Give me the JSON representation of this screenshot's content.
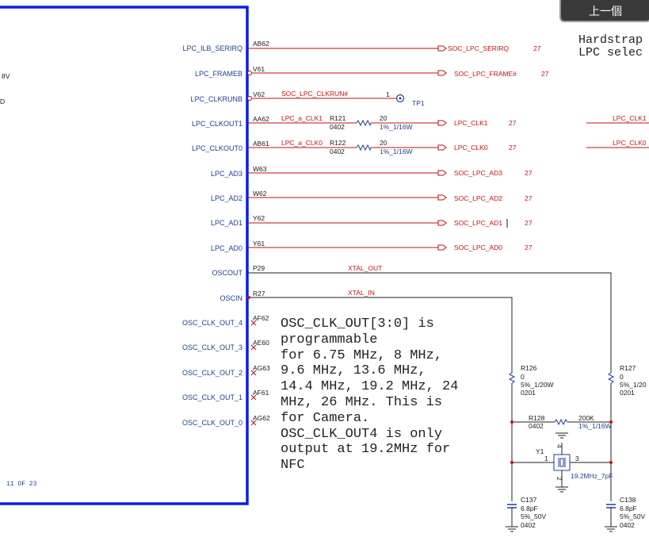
{
  "prev_button": "上一個",
  "hardstrap": [
    "Hardstrap",
    "LPC selec"
  ],
  "left_fragments": {
    "v": "8V",
    "d": "D"
  },
  "page_label": "11 OF 23",
  "pins": [
    {
      "name": "LPC_ILB_SERIRQ",
      "ball": "AB62",
      "net": "SOC_LPC_SERIRQ",
      "page": "27"
    },
    {
      "name": "LPC_FRAMEB",
      "ball": "V61",
      "net": "SOC_LPC_FRAME#",
      "page": "27"
    },
    {
      "name": "LPC_CLKRUNB",
      "ball": "V62",
      "net": "SOC_LPC_CLKRUN#",
      "page": ""
    },
    {
      "name": "LPC_CLKOUT1",
      "ball": "AA62",
      "net": "LPC_a_CLK1",
      "page": ""
    },
    {
      "name": "LPC_CLKOUT0",
      "ball": "AB61",
      "net": "LPC_a_CLK0",
      "page": ""
    },
    {
      "name": "LPC_AD3",
      "ball": "W63",
      "net": "SOC_LPC_AD3",
      "page": "27"
    },
    {
      "name": "LPC_AD2",
      "ball": "W62",
      "net": "SOC_LPC_AD2",
      "page": "27"
    },
    {
      "name": "LPC_AD1",
      "ball": "Y62",
      "net": "SOC_LPC_AD1",
      "page": "27"
    },
    {
      "name": "LPC_AD0",
      "ball": "Y61",
      "net": "SOC_LPC_AD0",
      "page": "27"
    },
    {
      "name": "OSCOUT",
      "ball": "P29",
      "net": "XTAL_OUT",
      "page": ""
    },
    {
      "name": "OSCIN",
      "ball": "R27",
      "net": "XTAL_IN",
      "page": ""
    },
    {
      "name": "OSC_CLK_OUT_4",
      "ball": "AF62",
      "net": "",
      "page": ""
    },
    {
      "name": "OSC_CLK_OUT_3",
      "ball": "AE60",
      "net": "",
      "page": ""
    },
    {
      "name": "OSC_CLK_OUT_2",
      "ball": "AG63",
      "net": "",
      "page": ""
    },
    {
      "name": "OSC_CLK_OUT_1",
      "ball": "AF61",
      "net": "",
      "page": ""
    },
    {
      "name": "OSC_CLK_OUT_0",
      "ball": "AG62",
      "net": "",
      "page": ""
    }
  ],
  "tp1": {
    "pin": "1",
    "label": "TP1"
  },
  "r121": {
    "ref": "R121",
    "value": "20",
    "pkg": "0402",
    "tol": "1%_1/16W",
    "out_net": "LPC_CLK1",
    "page": "27",
    "far_net": "LPC_CLK1"
  },
  "r122": {
    "ref": "R122",
    "value": "20",
    "pkg": "0402",
    "tol": "1%_1/16W",
    "out_net": "LPC_CLK0",
    "page": "27",
    "far_net": "LPC_CLK0"
  },
  "r126": {
    "ref": "R126",
    "value": "0",
    "tol": "5%_1/20W",
    "pkg": "0201"
  },
  "r127": {
    "ref": "R127",
    "value": "0",
    "tol": "5%_1/20",
    "pkg": "0201"
  },
  "r128": {
    "ref": "R128",
    "value": "200K",
    "pkg": "0402",
    "tol": "1%_1/16W"
  },
  "y1": {
    "ref": "Y1",
    "freq": "19.2MHz_7pF",
    "p1": "1",
    "p2": "2",
    "p3": "3",
    "p4": "4"
  },
  "c137": {
    "ref": "C137",
    "value": "6.8pF",
    "tol": "5%_50V",
    "pkg": "0402"
  },
  "c138": {
    "ref": "C138",
    "value": "6.8pF",
    "tol": "5%_50V",
    "pkg": "0402"
  },
  "note": [
    "OSC_CLK_OUT[3:0] is",
    "programmable",
    "for 6.75 MHz, 8 MHz,",
    "9.6 MHz, 13.6 MHz,",
    "14.4 MHz, 19.2 MHz, 24",
    "MHz, 26 MHz. This is",
    "for Camera.",
    "OSC_CLK_OUT4 is only",
    "output at 19.2MHz for",
    "NFC"
  ]
}
